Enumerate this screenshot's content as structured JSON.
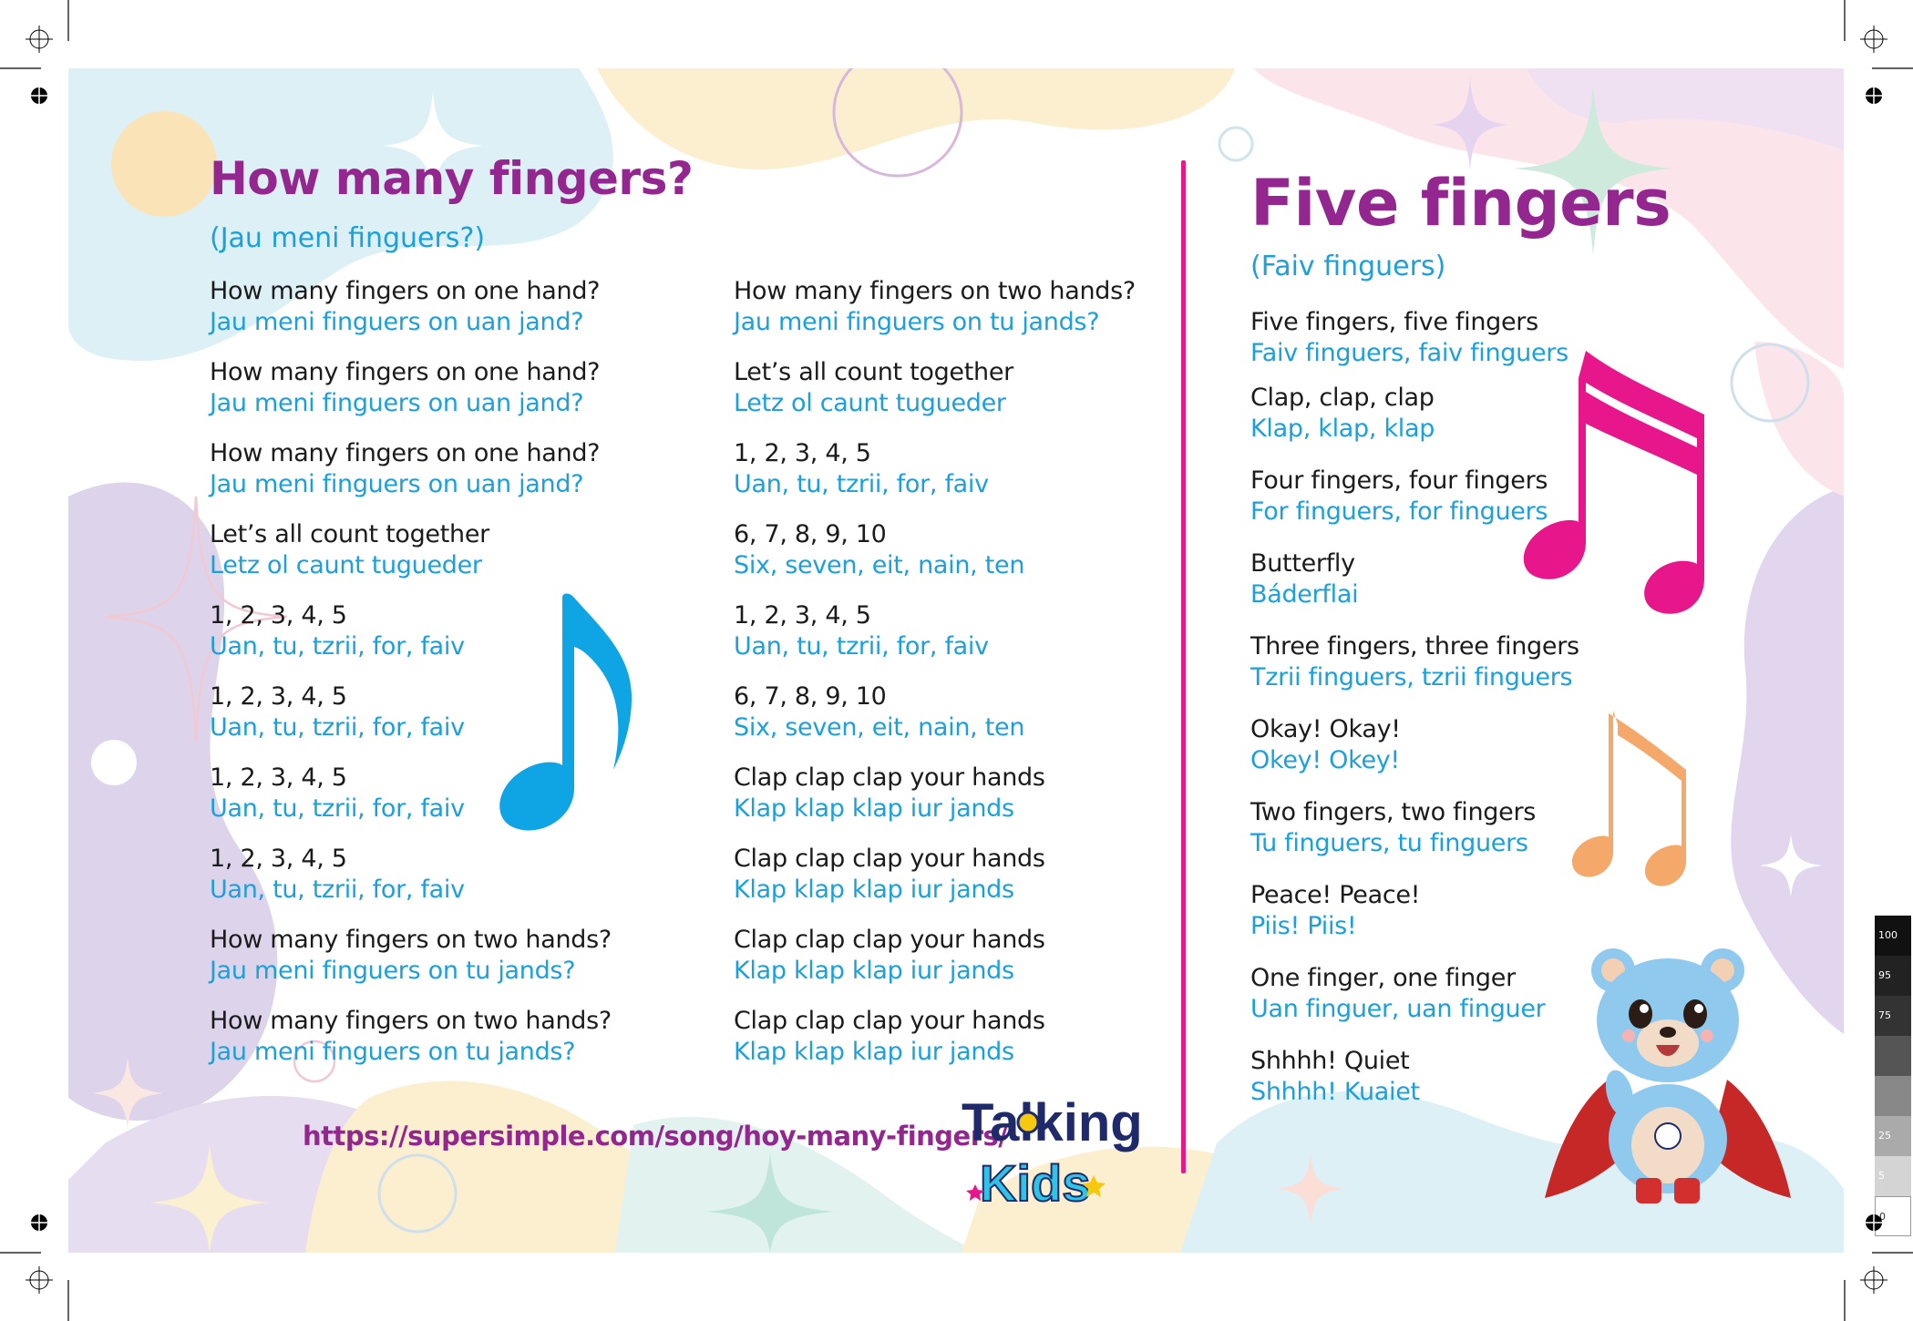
{
  "left_song": {
    "title": "How many fingers?",
    "subtitle": "(Jau meni finguers?)",
    "col1": [
      {
        "en": "How many fingers on one hand?",
        "ph": "Jau meni finguers on uan jand?"
      },
      {
        "en": "How many fingers on one hand?",
        "ph": "Jau meni finguers on uan jand?"
      },
      {
        "en": "How many fingers on one hand?",
        "ph": "Jau meni finguers on uan jand?"
      },
      {
        "en": "Let’s all count together",
        "ph": "Letz ol caunt tugueder"
      },
      {
        "en": "1, 2, 3, 4, 5",
        "ph": "Uan, tu, tzrii, for, faiv"
      },
      {
        "en": "1, 2, 3, 4, 5",
        "ph": "Uan, tu, tzrii, for, faiv"
      },
      {
        "en": "1, 2, 3, 4, 5",
        "ph": "Uan, tu, tzrii, for, faiv"
      },
      {
        "en": "1, 2, 3, 4, 5",
        "ph": "Uan, tu, tzrii, for, faiv"
      },
      {
        "en": "How many fingers on two hands?",
        "ph": "Jau meni finguers on tu jands?"
      },
      {
        "en": "How many fingers on two hands?",
        "ph": "Jau meni finguers on tu jands?"
      }
    ],
    "col2": [
      {
        "en": "How many fingers on two hands?",
        "ph": "Jau meni finguers on tu jands?"
      },
      {
        "en": "Let’s all count together",
        "ph": "Letz ol caunt tugueder"
      },
      {
        "en": "1, 2, 3, 4, 5",
        "ph": "Uan, tu, tzrii, for, faiv"
      },
      {
        "en": "6, 7, 8, 9, 10",
        "ph": "Six, seven, eit, nain, ten"
      },
      {
        "en": "1, 2, 3, 4, 5",
        "ph": "Uan, tu, tzrii, for, faiv"
      },
      {
        "en": "6, 7, 8, 9, 10",
        "ph": "Six, seven, eit, nain, ten"
      },
      {
        "en": "Clap clap clap your hands",
        "ph": "Klap klap klap iur jands"
      },
      {
        "en": "Clap clap clap your hands",
        "ph": "Klap klap klap iur jands"
      },
      {
        "en": "Clap clap clap your hands",
        "ph": "Klap klap klap iur jands"
      },
      {
        "en": "Clap clap clap your hands",
        "ph": "Klap klap klap iur jands"
      }
    ],
    "url": "https://supersimple.com/song/hoy-many-fingers/"
  },
  "right_song": {
    "title": "Five fingers",
    "subtitle": "(Faiv finguers)",
    "verses": [
      {
        "en": "Five fingers, five fingers",
        "ph": "Faiv finguers, faiv finguers"
      },
      {
        "en": "Clap, clap, clap",
        "ph": "Klap, klap, klap"
      },
      {
        "en": "Four fingers, four fingers",
        "ph": "For finguers, for finguers"
      },
      {
        "en": "Butterfly",
        "ph": "Báderflai"
      },
      {
        "en": "Three fingers, three fingers",
        "ph": "Tzrii finguers, tzrii finguers"
      },
      {
        "en": "Okay! Okay!",
        "ph": "Okey! Okey!"
      },
      {
        "en": "Two fingers, two fingers",
        "ph": "Tu finguers, tu finguers"
      },
      {
        "en": "Peace! Peace!",
        "ph": "Piis! Piis!"
      },
      {
        "en": "One finger, one finger",
        "ph": "Uan finguer, uan finguer"
      },
      {
        "en": "Shhhh! Quiet",
        "ph": "Shhhh! Kuaiet"
      }
    ]
  },
  "logo": {
    "line1": "Talking",
    "line2": "Kids"
  },
  "color_bar": {
    "steps": [
      "100",
      "95",
      "75",
      "",
      "",
      "25",
      "5",
      "0"
    ]
  },
  "colors": {
    "title_purple": "#93278f",
    "phonetic_blue": "#1ba0dc",
    "divider_pink": "#e5198a",
    "note_blue": "#0fa4e4",
    "note_pink": "#e8168b",
    "note_orange": "#f4a86a"
  },
  "icons": [
    "music-note-icon",
    "double-music-note-icon",
    "sparkle-icon",
    "registration-mark-icon",
    "bear-mascot",
    "talking-kids-logo"
  ]
}
